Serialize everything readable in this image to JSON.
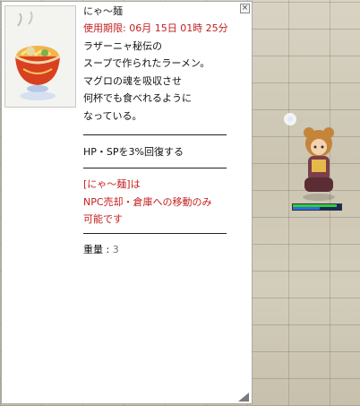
{
  "item_window": {
    "title": "にゃ〜麺",
    "close_label": "×",
    "expiry": "使用期限: 06月 15日 01時 25分",
    "description": [
      "ラザーニャ秘伝の",
      "スープで作られたラーメン。",
      "マグロの魂を吸収させ",
      "何杯でも食べれるように",
      "なっている。"
    ],
    "effect": "HP・SPを3%回復する",
    "restriction": [
      "[にゃ〜麺]は",
      "NPC売却・倉庫への移動のみ",
      "可能です"
    ],
    "weight_label": "重量 : ",
    "weight_value": "3",
    "icon": "ramen-bowl-icon"
  },
  "character": {
    "hp_fraction": 0.9,
    "sp_fraction": 0.55
  },
  "colors": {
    "restriction_text": "#c41e1e",
    "hp": "#2ecc40",
    "sp": "#2d6be0"
  }
}
